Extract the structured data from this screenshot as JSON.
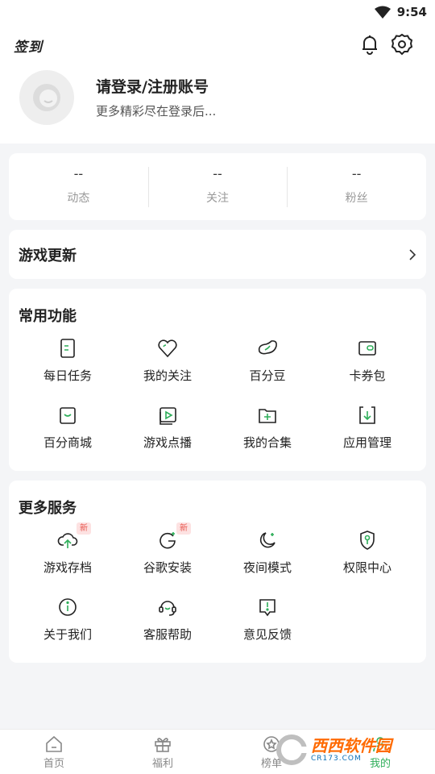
{
  "status_bar": {
    "time": "9:54"
  },
  "header": {
    "sign_in": "签到"
  },
  "profile": {
    "title": "请登录/注册账号",
    "subtitle": "更多精彩尽在登录后..."
  },
  "stats": [
    {
      "value": "--",
      "label": "动态"
    },
    {
      "value": "--",
      "label": "关注"
    },
    {
      "value": "--",
      "label": "粉丝"
    }
  ],
  "game_update": {
    "label": "游戏更新"
  },
  "common_functions": {
    "title": "常用功能",
    "items": [
      {
        "label": "每日任务",
        "icon": "task-icon"
      },
      {
        "label": "我的关注",
        "icon": "heart-icon"
      },
      {
        "label": "百分豆",
        "icon": "bean-icon"
      },
      {
        "label": "卡券包",
        "icon": "wallet-icon"
      },
      {
        "label": "百分商城",
        "icon": "shop-icon"
      },
      {
        "label": "游戏点播",
        "icon": "play-icon"
      },
      {
        "label": "我的合集",
        "icon": "folder-add-icon"
      },
      {
        "label": "应用管理",
        "icon": "download-icon"
      }
    ]
  },
  "more_services": {
    "title": "更多服务",
    "items": [
      {
        "label": "游戏存档",
        "icon": "cloud-upload-icon",
        "badge": "新"
      },
      {
        "label": "谷歌安装",
        "icon": "google-icon",
        "badge": "新"
      },
      {
        "label": "夜间模式",
        "icon": "moon-icon"
      },
      {
        "label": "权限中心",
        "icon": "shield-key-icon"
      },
      {
        "label": "关于我们",
        "icon": "info-icon"
      },
      {
        "label": "客服帮助",
        "icon": "headset-icon"
      },
      {
        "label": "意见反馈",
        "icon": "feedback-icon"
      }
    ]
  },
  "tabbar": [
    {
      "label": "首页",
      "icon": "home-icon"
    },
    {
      "label": "福利",
      "icon": "gift-icon"
    },
    {
      "label": "榜单",
      "icon": "star-icon"
    },
    {
      "label": "我的",
      "icon": "user-icon"
    }
  ],
  "watermark": {
    "title": "西西软件园",
    "subtitle": "CR173.COM"
  },
  "colors": {
    "accent": "#2fae5a",
    "badge_bg": "#fde2e2",
    "badge_text": "#e8574e",
    "background": "#f4f5f7"
  }
}
